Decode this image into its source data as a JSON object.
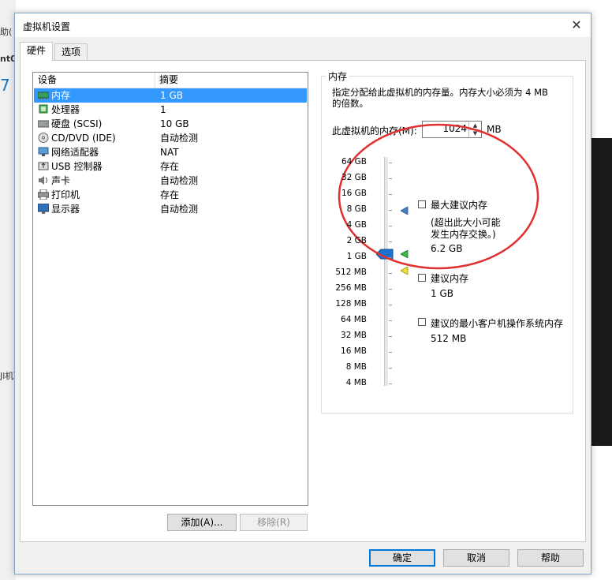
{
  "background": {
    "left_fragments": [
      "助(",
      "nt0",
      "7",
      "Jl机ì"
    ]
  },
  "dialog": {
    "title": "虚拟机设置",
    "close_glyph": "✕",
    "tabs": [
      "硬件",
      "选项"
    ]
  },
  "device_list": {
    "headers": {
      "device": "设备",
      "summary": "摘要"
    },
    "rows": [
      {
        "icon": "memory-icon",
        "name": "内存",
        "summary": "1 GB",
        "selected": true
      },
      {
        "icon": "processor-icon",
        "name": "处理器",
        "summary": "1"
      },
      {
        "icon": "harddisk-icon",
        "name": "硬盘 (SCSI)",
        "summary": "10 GB"
      },
      {
        "icon": "cd-dvd-icon",
        "name": "CD/DVD (IDE)",
        "summary": "自动检测"
      },
      {
        "icon": "network-adapter-icon",
        "name": "网络适配器",
        "summary": "NAT"
      },
      {
        "icon": "usb-icon",
        "name": "USB 控制器",
        "summary": "存在"
      },
      {
        "icon": "sound-card-icon",
        "name": "声卡",
        "summary": "自动检测"
      },
      {
        "icon": "printer-icon",
        "name": "打印机",
        "summary": "存在"
      },
      {
        "icon": "display-icon",
        "name": "显示器",
        "summary": "自动检测"
      }
    ]
  },
  "list_buttons": {
    "add": "添加(A)...",
    "remove": "移除(R)"
  },
  "memory": {
    "group_title": "内存",
    "description_line1": "指定分配给此虚拟机的内存量。内存大小必须为 4 MB",
    "description_line2": "的倍数。",
    "field_label": "此虚拟机的内存(M):",
    "value": "1024",
    "unit": "MB",
    "scale": [
      "64 GB",
      "32 GB",
      "16 GB",
      "8 GB",
      "4 GB",
      "2 GB",
      "1 GB",
      "512 MB",
      "256 MB",
      "128 MB",
      "64 MB",
      "32 MB",
      "16 MB",
      "8 MB",
      "4 MB"
    ],
    "legend": {
      "max": {
        "title": "最大建议内存",
        "note_line1": "(超出此大小可能",
        "note_line2": "发生内存交换。)",
        "value": "6.2 GB",
        "color": "#4a7fc1"
      },
      "recommended": {
        "title": "建议内存",
        "value": "1 GB",
        "color": "#3fb54a"
      },
      "min": {
        "title": "建议的最小客户机操作系统内存",
        "value": "512 MB",
        "color": "#f0e040"
      }
    },
    "annotation_circle_color": "#e03030"
  },
  "footer": {
    "ok": "确定",
    "cancel": "取消",
    "help": "帮助"
  }
}
